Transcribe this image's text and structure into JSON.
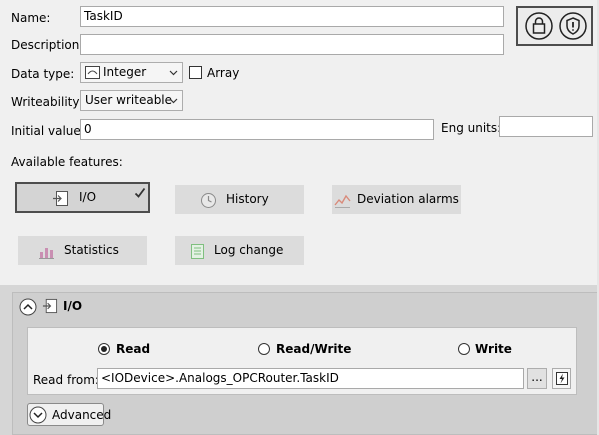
{
  "form": {
    "name_label": "Name:",
    "name_value": "TaskID",
    "description_label": "Description:",
    "description_value": "",
    "datatype_label": "Data type:",
    "datatype_value": "Integer",
    "array_label": "Array",
    "writeability_label": "Writeability:",
    "writeability_value": "User writeable",
    "initial_label": "Initial value:",
    "initial_value": "0",
    "engunits_label": "Eng units:",
    "engunits_value": ""
  },
  "features": {
    "heading": "Available features:",
    "io": "I/O",
    "history": "History",
    "deviation": "Deviation alarms",
    "statistics": "Statistics",
    "logchange": "Log change"
  },
  "io_panel": {
    "title": "I/O",
    "read": "Read",
    "readwrite": "Read/Write",
    "write": "Write",
    "read_from_label": "Read from:",
    "read_from_value": "<IODevice>.Analogs_OPCRouter.TaskID",
    "browse": "...",
    "advanced": "Advanced"
  },
  "colors": {
    "panel_header": "#cfcfcf",
    "feature_button": "#dcdcdc",
    "active_border": "#4d4d4d"
  }
}
